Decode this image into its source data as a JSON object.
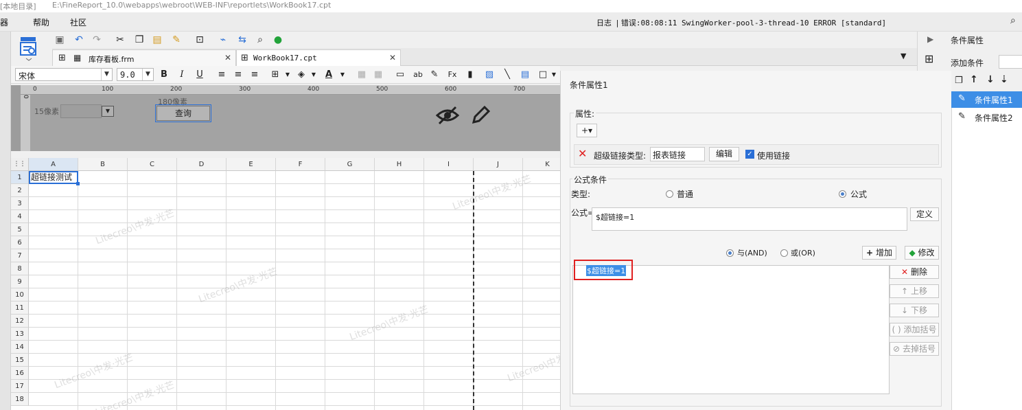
{
  "titlebar": {
    "left": "[本地目录]",
    "path": "E:\\FineReport_10.0\\webapps\\webroot\\WEB-INF\\reportlets\\WorkBook17.cpt"
  },
  "menubar": {
    "items": [
      "器",
      "帮助",
      "社区"
    ],
    "log_label": "日志",
    "error_label": "错误",
    "log_text": ":08:08:11 SwingWorker-pool-3-thread-10 ERROR [standard]"
  },
  "tabs": [
    {
      "label": "库存看板.frm"
    },
    {
      "label": "WorkBook17.cpt"
    }
  ],
  "format": {
    "font": "宋体",
    "size": "9.0"
  },
  "ruler": {
    "ticks": [
      "0",
      "100",
      "200",
      "300",
      "400",
      "500",
      "600",
      "700"
    ]
  },
  "form": {
    "label1": "15像素",
    "label2": "180像素",
    "query_button": "查询"
  },
  "sheet": {
    "columns": [
      "A",
      "B",
      "C",
      "D",
      "E",
      "F",
      "G",
      "H",
      "I",
      "J",
      "K"
    ],
    "rows": [
      "1",
      "2",
      "3",
      "4",
      "5",
      "6",
      "7",
      "8",
      "9",
      "10",
      "11",
      "12",
      "13",
      "14",
      "15",
      "16",
      "17",
      "18"
    ],
    "cell_a1": "超链接测试",
    "watermark": "Litecreo\\中发·光芒"
  },
  "dialog": {
    "title": "条件属性1",
    "attr_group": "属性:",
    "hyperlink_type_label": "超级链接类型:",
    "hyperlink_type_value": "报表链接",
    "edit_button": "编辑",
    "use_link_label": "使用链接",
    "formula_group": "公式条件",
    "type_label": "类型:",
    "type_normal": "普通",
    "type_formula": "公式",
    "formula_label": "公式=",
    "formula_value": "$超链接=1",
    "define_button": "定义",
    "and_label": "与(AND)",
    "or_label": "或(OR)",
    "add_button": "增加",
    "modify_button": "修改",
    "list_item": "$超链接=1",
    "delete_button": "删除",
    "up_button": "上移",
    "down_button": "下移",
    "add_bracket_button": "添加括号",
    "remove_bracket_button": "去掉括号"
  },
  "rightpanel": {
    "title": "条件属性",
    "add_condition": "添加条件",
    "conditions": [
      "条件属性1",
      "条件属性2"
    ]
  },
  "colors": {
    "selection": "#3d8ee6",
    "highlight_border": "#e02020",
    "accent": "#2a6fd6"
  }
}
